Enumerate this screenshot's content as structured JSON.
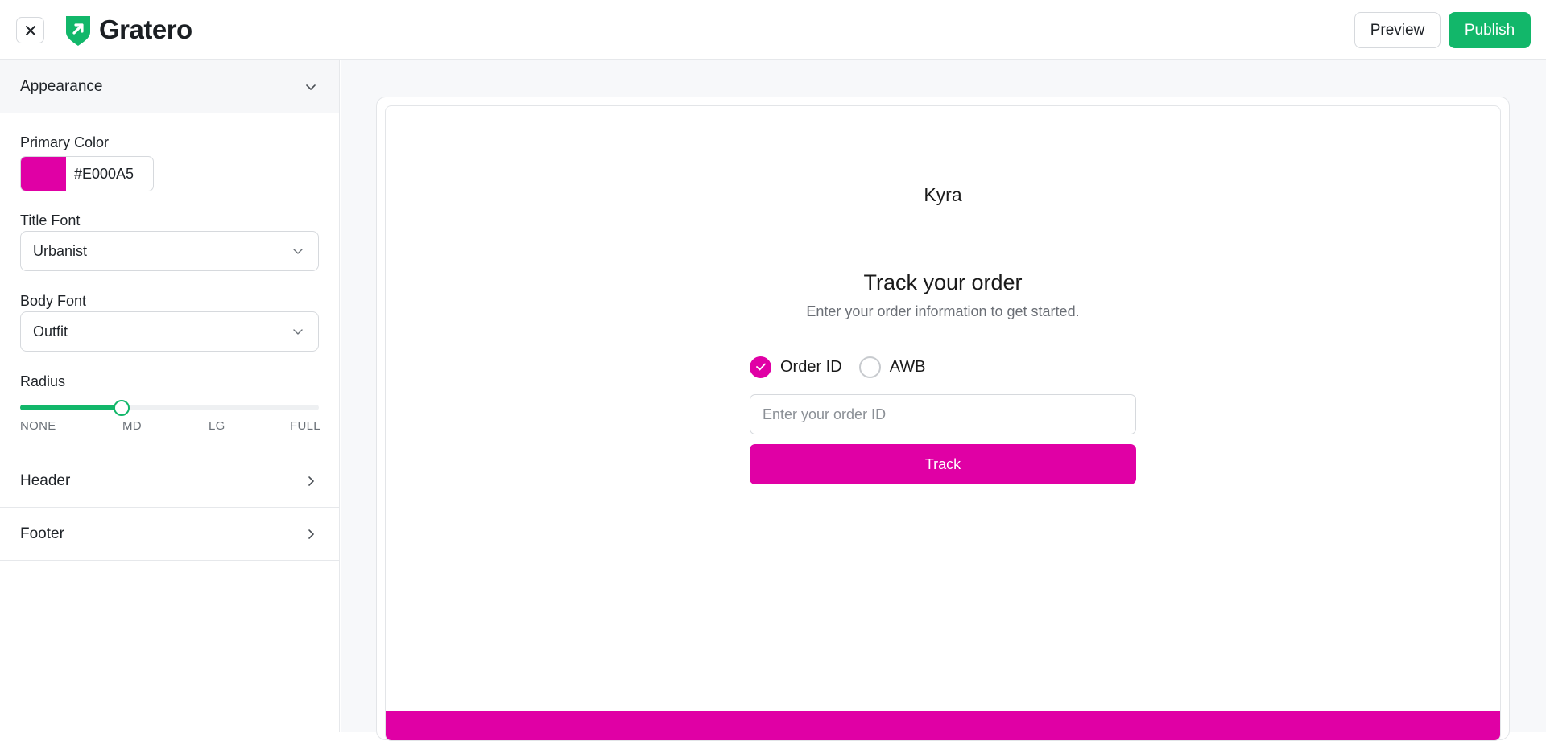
{
  "app": {
    "brand": "Gratero",
    "brand_color": "#12b76a"
  },
  "topbar": {
    "close_icon": "close-icon",
    "preview_label": "Preview",
    "publish_label": "Publish"
  },
  "sidebar": {
    "appearance": {
      "title": "Appearance",
      "expanded": true,
      "primary_color_label": "Primary Color",
      "primary_color_value": "#E000A5",
      "title_font_label": "Title Font",
      "title_font_value": "Urbanist",
      "body_font_label": "Body Font",
      "body_font_value": "Outfit",
      "radius_label": "Radius",
      "radius_ticks": [
        "NONE",
        "MD",
        "LG",
        "FULL"
      ],
      "radius_selected": "MD",
      "radius_level_fraction": 0.34
    },
    "header": {
      "title": "Header",
      "expanded": false
    },
    "footer": {
      "title": "Footer",
      "expanded": false
    }
  },
  "preview": {
    "store_name": "Kyra",
    "title": "Track your order",
    "subtitle": "Enter your order information to get started.",
    "options": [
      {
        "label": "Order ID",
        "checked": true
      },
      {
        "label": "AWB",
        "checked": false
      }
    ],
    "input_placeholder": "Enter your order ID",
    "input_value": "",
    "track_label": "Track",
    "accent": "#E000A5"
  }
}
